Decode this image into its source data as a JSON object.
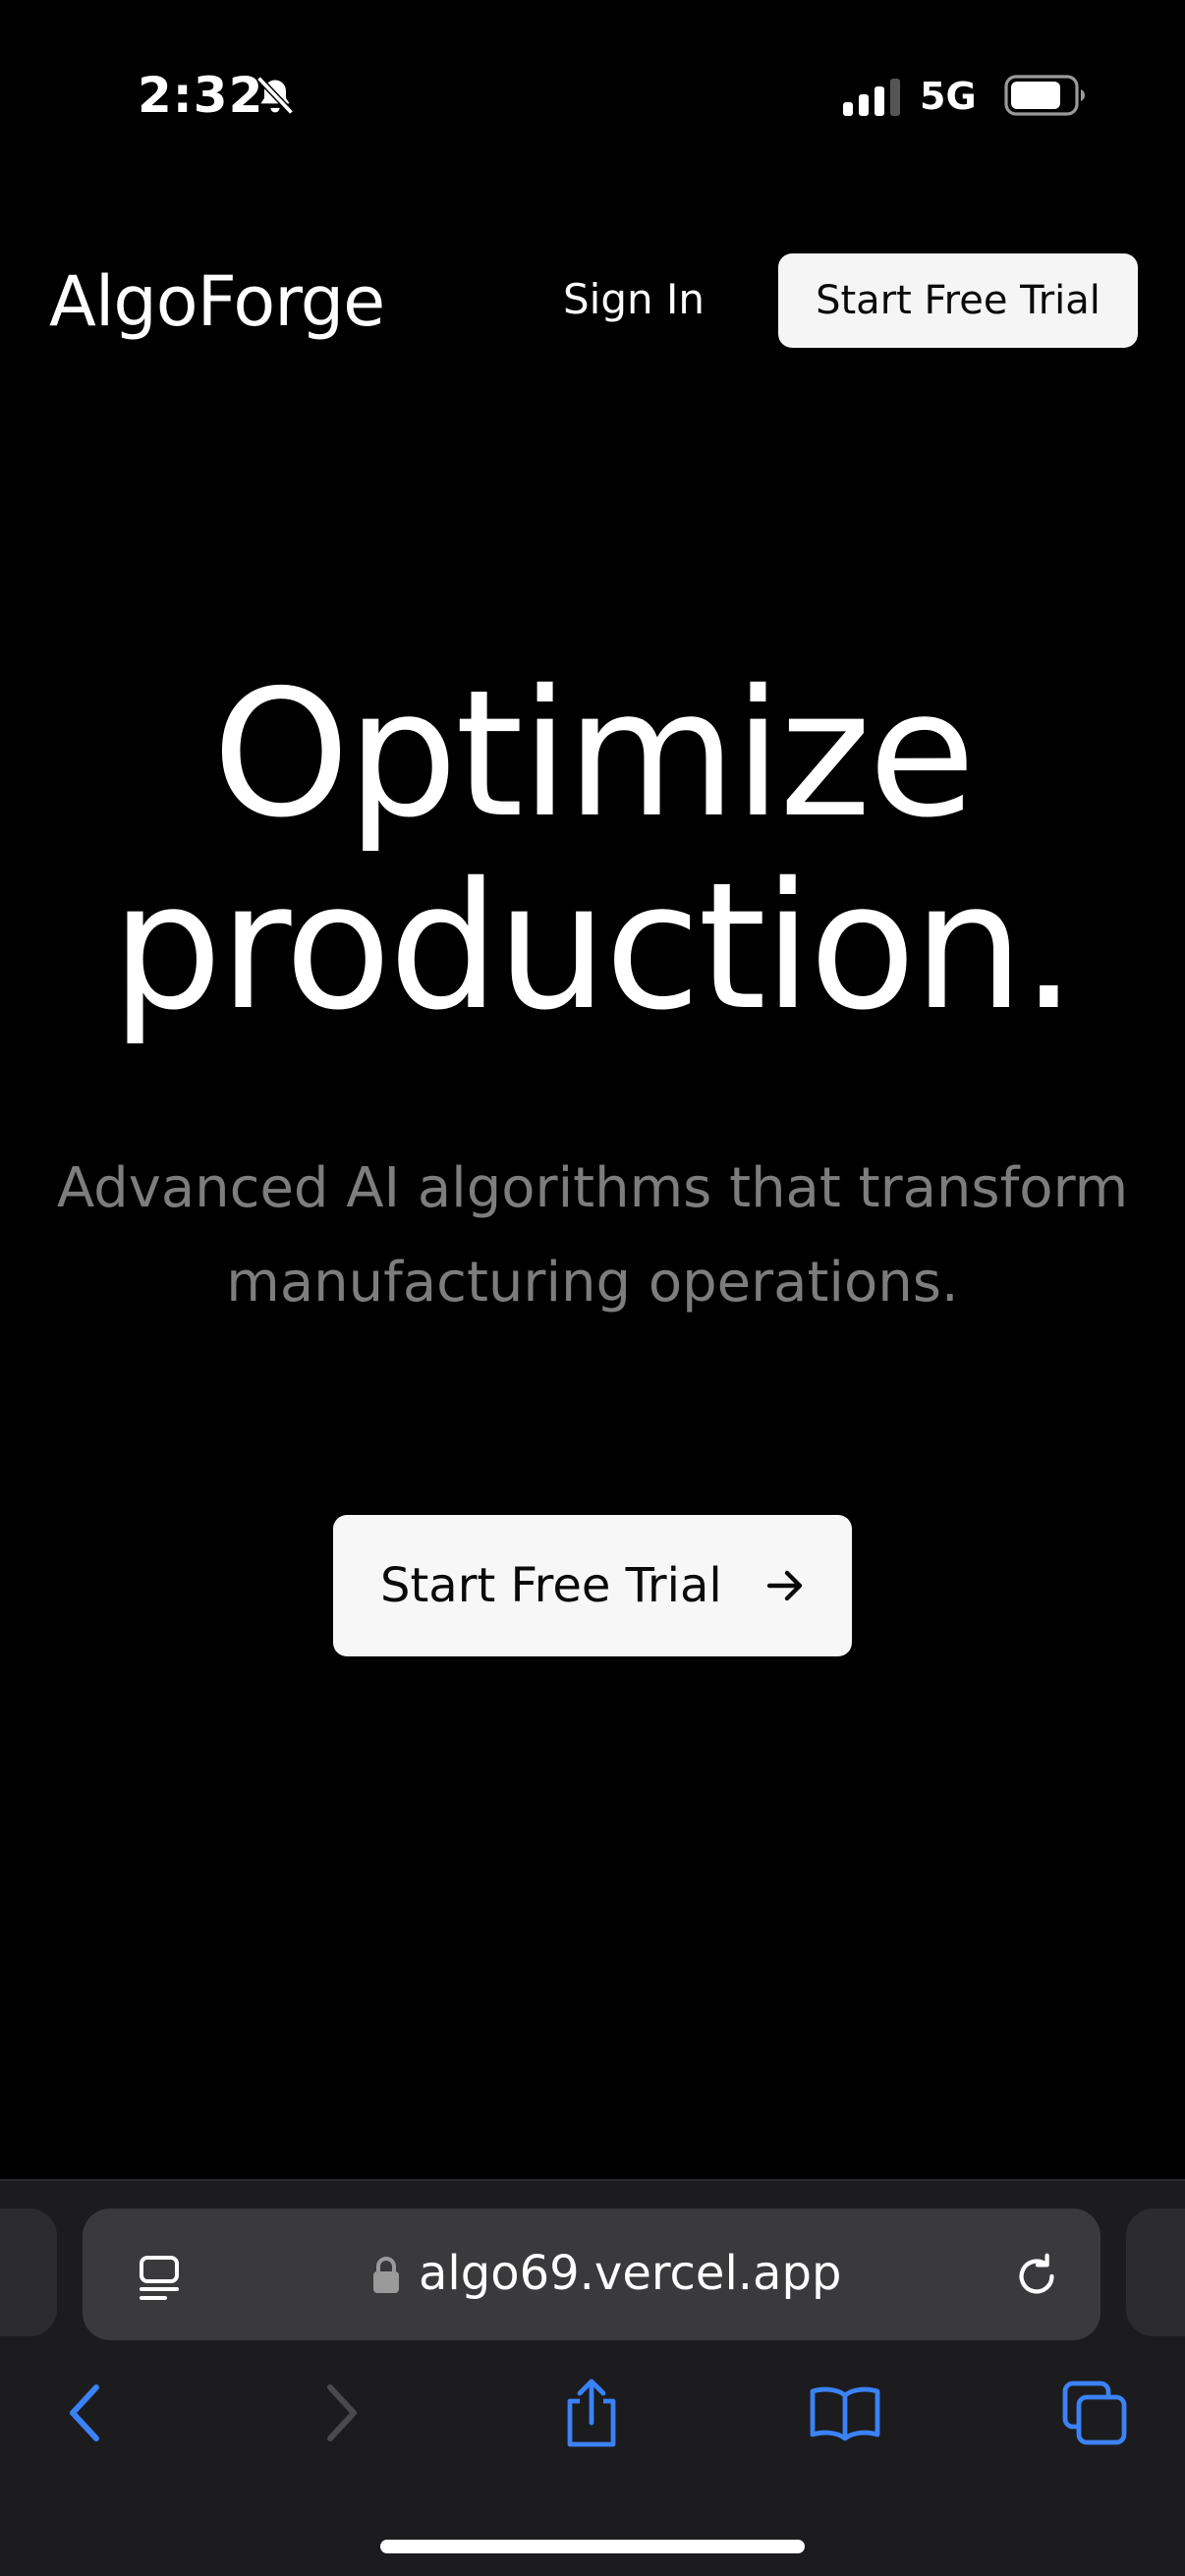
{
  "status_bar": {
    "time": "2:32",
    "network": "5G",
    "icons": [
      "bell-slash-icon",
      "signal-icon",
      "battery-icon"
    ]
  },
  "header": {
    "brand": "AlgoForge",
    "sign_in": "Sign In",
    "cta": "Start Free Trial"
  },
  "hero": {
    "title_line1": "Optimize",
    "title_line2": "production.",
    "subtitle": "Advanced AI algorithms that transform manufacturing operations.",
    "cta": "Start Free Trial",
    "cta_icon": "arrow-right-icon"
  },
  "browser": {
    "url": "algo69.vercel.app",
    "toolbar_icons": [
      "back-icon",
      "forward-icon",
      "share-icon",
      "bookmarks-icon",
      "tabs-icon"
    ]
  },
  "colors": {
    "background": "#000000",
    "text": "#ffffff",
    "muted_text": "#7d7d7d",
    "button_bg": "#f5f5f5",
    "accent_blue": "#3b82f6",
    "browser_bar": "#1c1c1e"
  }
}
